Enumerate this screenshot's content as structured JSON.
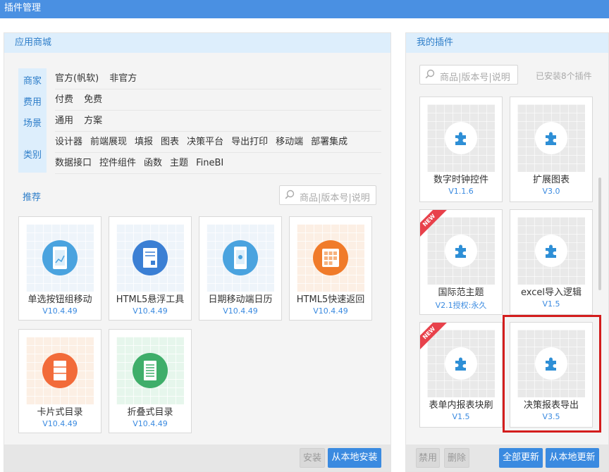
{
  "window": {
    "title": "插件管理"
  },
  "store": {
    "header": "应用商城",
    "filters": {
      "categories": [
        "商家",
        "费用",
        "场景",
        "类别"
      ],
      "rows": [
        [
          "官方(帆软)",
          "非官方"
        ],
        [
          "付费",
          "免费"
        ],
        [
          "通用",
          "方案"
        ],
        [
          "设计器",
          "前端展现",
          "填报",
          "图表",
          "决策平台",
          "导出打印",
          "移动端",
          "部署集成"
        ],
        [
          "数据接口",
          "控件组件",
          "函数",
          "主题",
          "FineBI"
        ]
      ]
    },
    "recommend_label": "推荐",
    "search_placeholder": "商品|版本号|说明",
    "cards": [
      {
        "name": "单选按钮组移动",
        "version": "V10.4.49",
        "icon": "mobile-chart-icon",
        "color": "#4aa3df"
      },
      {
        "name": "HTML5悬浮工具",
        "version": "V10.4.49",
        "icon": "document-icon",
        "color": "#3b7fd4"
      },
      {
        "name": "日期移动端日历",
        "version": "V10.4.49",
        "icon": "mobile-calendar-icon",
        "color": "#4aa3df"
      },
      {
        "name": "HTML5快速返回",
        "version": "V10.4.49",
        "icon": "grid-back-icon",
        "color": "#f07b2a"
      },
      {
        "name": "卡片式目录",
        "version": "V10.4.49",
        "icon": "card-list-icon",
        "color": "#f26b3a"
      },
      {
        "name": "折叠式目录",
        "version": "V10.4.49",
        "icon": "folded-list-icon",
        "color": "#3fae6a"
      }
    ],
    "footer": {
      "install": "安装",
      "local_install": "从本地安装"
    }
  },
  "mine": {
    "header": "我的插件",
    "search_placeholder": "商品|版本号|说明",
    "installed_count": "已安装8个插件",
    "cards": [
      {
        "name": "数字时钟控件",
        "version": "V1.1.6",
        "is_new": false
      },
      {
        "name": "扩展图表",
        "version": "V3.0",
        "is_new": false
      },
      {
        "name": "国际范主题",
        "version": "V2.1授权:永久",
        "is_new": true
      },
      {
        "name": "excel导入逻辑",
        "version": "V1.5",
        "is_new": false
      },
      {
        "name": "表单内报表块刷",
        "version": "V1.5",
        "is_new": true
      },
      {
        "name": "决策报表导出",
        "version": "V3.5",
        "is_new": false,
        "highlighted": true
      }
    ],
    "new_ribbon": "NEW",
    "footer": {
      "disable": "禁用",
      "delete": "删除",
      "update_all": "全部更新",
      "local_update": "从本地更新"
    }
  }
}
